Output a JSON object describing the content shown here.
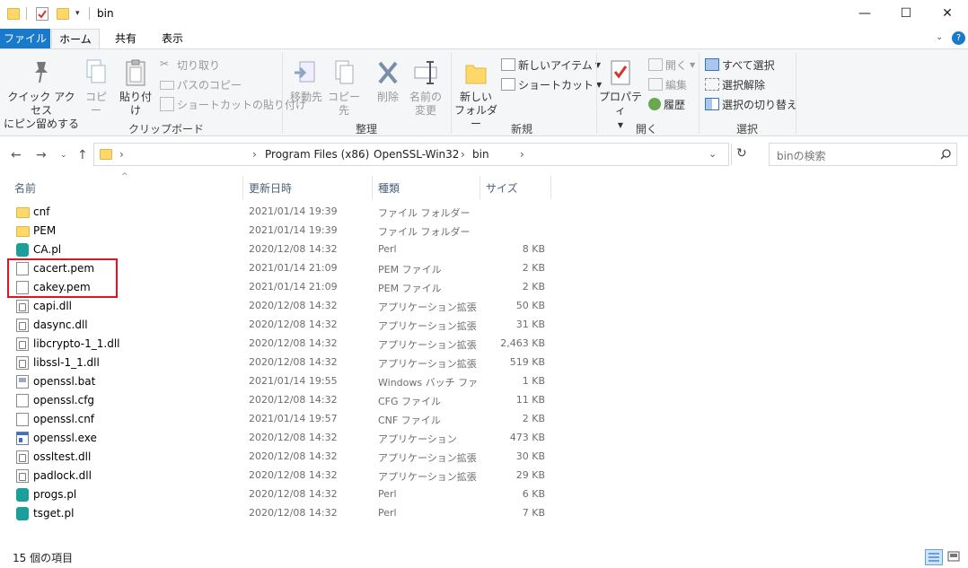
{
  "window": {
    "title": "bin",
    "minimize_glyph": "—",
    "maximize_glyph": "☐",
    "close_glyph": "✕"
  },
  "tabs": [
    "ファイル",
    "ホーム",
    "共有",
    "表示"
  ],
  "ribbon": {
    "clipboard": {
      "pin_label_1": "クイック アクセス",
      "pin_label_2": "にピン留めする",
      "copy": "コピー",
      "paste": "貼り付け",
      "cut": "切り取り",
      "copy_path": "パスのコピー",
      "paste_shortcut": "ショートカットの貼り付け",
      "group": "クリップボード"
    },
    "organize": {
      "move_to": "移動先",
      "copy_to": "コピー先",
      "delete": "削除",
      "rename_1": "名前の",
      "rename_2": "変更",
      "group": "整理"
    },
    "new": {
      "new_folder_1": "新しい",
      "new_folder_2": "フォルダー",
      "new_item": "新しいアイテム",
      "easy_access": "ショートカット",
      "group": "新規"
    },
    "open": {
      "properties": "プロパティ",
      "open": "開く",
      "edit": "編集",
      "history": "履歴",
      "group": "開く"
    },
    "select": {
      "select_all": "すべて選択",
      "select_none": "選択解除",
      "invert": "選択の切り替え",
      "group": "選択"
    }
  },
  "address": {
    "crumbs": [
      "Program Files (x86)",
      "OpenSSL-Win32",
      "bin"
    ],
    "search_placeholder": "binの検索"
  },
  "columns": {
    "name": "名前",
    "date": "更新日時",
    "type": "種類",
    "size": "サイズ"
  },
  "files": [
    {
      "name": "cnf",
      "date": "2021/01/14 19:39",
      "type": "ファイル フォルダー",
      "size": "",
      "icon": "folder-icon"
    },
    {
      "name": "PEM",
      "date": "2021/01/14 19:39",
      "type": "ファイル フォルダー",
      "size": "",
      "icon": "folder-icon"
    },
    {
      "name": "CA.pl",
      "date": "2020/12/08 14:32",
      "type": "Perl",
      "size": "8 KB",
      "icon": "perl-icon"
    },
    {
      "name": "cacert.pem",
      "date": "2021/01/14 21:09",
      "type": "PEM ファイル",
      "size": "2 KB",
      "icon": "file-icon"
    },
    {
      "name": "cakey.pem",
      "date": "2021/01/14 21:09",
      "type": "PEM ファイル",
      "size": "2 KB",
      "icon": "file-icon"
    },
    {
      "name": "capi.dll",
      "date": "2020/12/08 14:32",
      "type": "アプリケーション拡張",
      "size": "50 KB",
      "icon": "dll-icon"
    },
    {
      "name": "dasync.dll",
      "date": "2020/12/08 14:32",
      "type": "アプリケーション拡張",
      "size": "31 KB",
      "icon": "dll-icon"
    },
    {
      "name": "libcrypto-1_1.dll",
      "date": "2020/12/08 14:32",
      "type": "アプリケーション拡張",
      "size": "2,463 KB",
      "icon": "dll-icon"
    },
    {
      "name": "libssl-1_1.dll",
      "date": "2020/12/08 14:32",
      "type": "アプリケーション拡張",
      "size": "519 KB",
      "icon": "dll-icon"
    },
    {
      "name": "openssl.bat",
      "date": "2021/01/14 19:55",
      "type": "Windows バッチ ファ...",
      "size": "1 KB",
      "icon": "bat-icon"
    },
    {
      "name": "openssl.cfg",
      "date": "2020/12/08 14:32",
      "type": "CFG ファイル",
      "size": "11 KB",
      "icon": "file-icon"
    },
    {
      "name": "openssl.cnf",
      "date": "2021/01/14 19:57",
      "type": "CNF ファイル",
      "size": "2 KB",
      "icon": "file-icon"
    },
    {
      "name": "openssl.exe",
      "date": "2020/12/08 14:32",
      "type": "アプリケーション",
      "size": "473 KB",
      "icon": "exe-icon"
    },
    {
      "name": "ossltest.dll",
      "date": "2020/12/08 14:32",
      "type": "アプリケーション拡張",
      "size": "30 KB",
      "icon": "dll-icon"
    },
    {
      "name": "padlock.dll",
      "date": "2020/12/08 14:32",
      "type": "アプリケーション拡張",
      "size": "29 KB",
      "icon": "dll-icon"
    },
    {
      "name": "progs.pl",
      "date": "2020/12/08 14:32",
      "type": "Perl",
      "size": "6 KB",
      "icon": "perl-icon"
    },
    {
      "name": "tsget.pl",
      "date": "2020/12/08 14:32",
      "type": "Perl",
      "size": "7 KB",
      "icon": "perl-icon"
    }
  ],
  "status": {
    "count_text": "15 個の項目"
  },
  "colors": {
    "file_tab": "#1979ca",
    "highlight": "#e81123",
    "folder": "#ffd867"
  }
}
